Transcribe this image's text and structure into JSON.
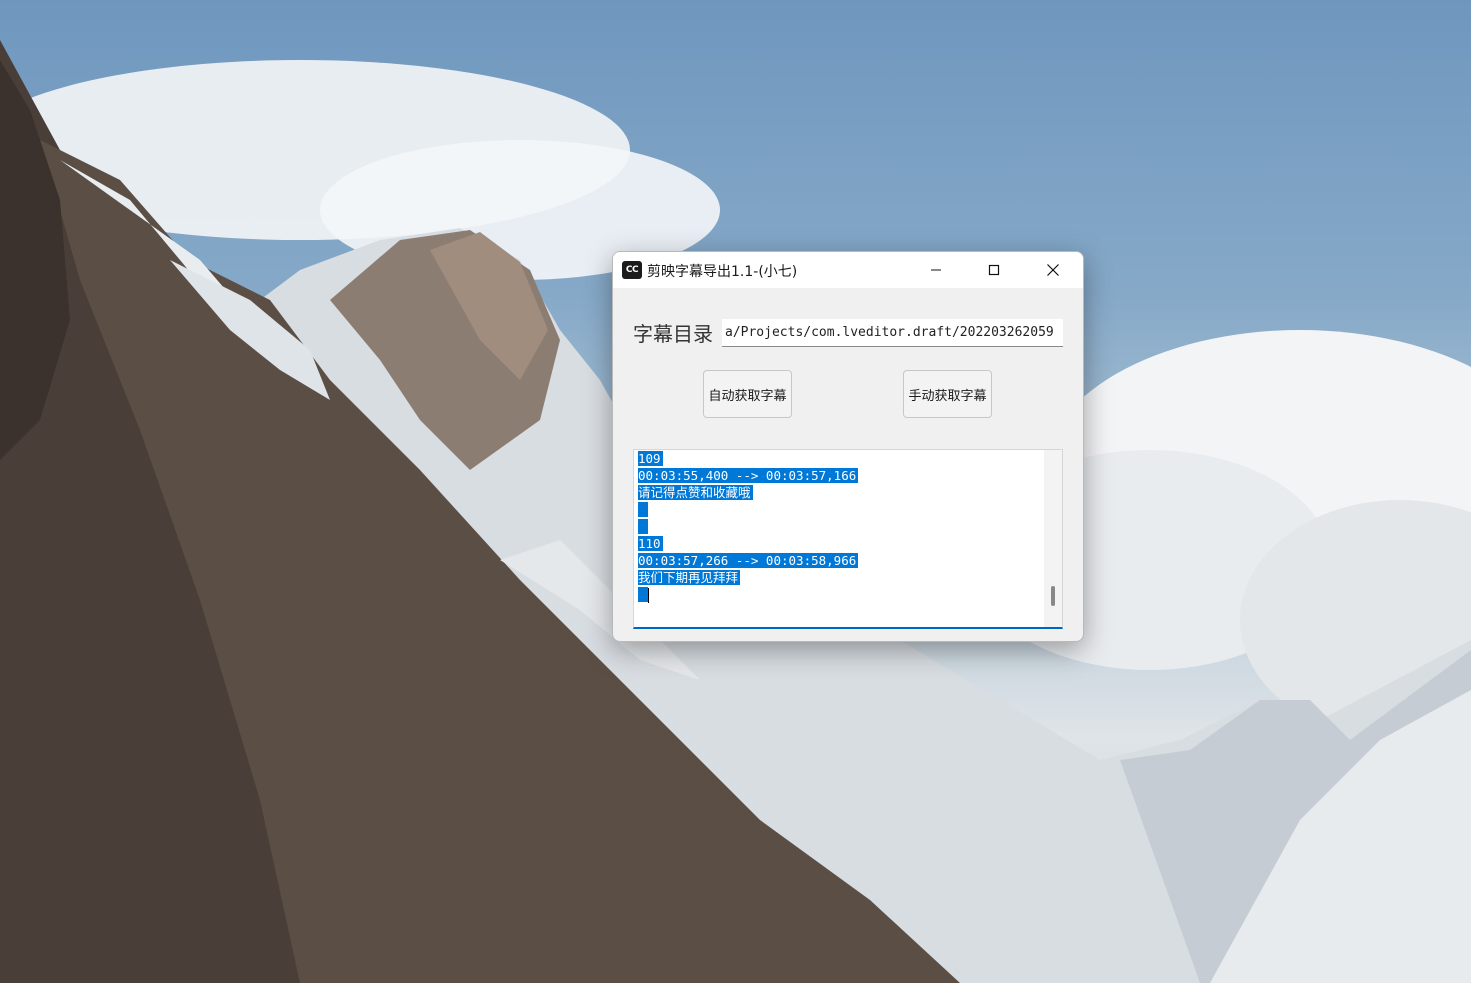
{
  "window": {
    "title": "剪映字幕导出1.1-(小七)",
    "icon_label": "CC"
  },
  "form": {
    "dir_label": "字幕目录",
    "dir_value": "a/Projects/com.lveditor.draft/202203262059"
  },
  "buttons": {
    "auto_label": "自动获取字幕",
    "manual_label": "手动获取字幕"
  },
  "subtitles": {
    "lines": [
      "109",
      "00:03:55,400 --> 00:03:57,166",
      "请记得点赞和收藏哦",
      "",
      "",
      "110",
      "00:03:57,266 --> 00:03:58,966",
      "我们下期再见拜拜",
      ""
    ]
  },
  "colors": {
    "selection": "#0078d7",
    "focus_underline": "#0067c0"
  },
  "icons": {
    "minimize": "minimize-icon",
    "maximize": "maximize-icon",
    "close": "close-icon"
  }
}
